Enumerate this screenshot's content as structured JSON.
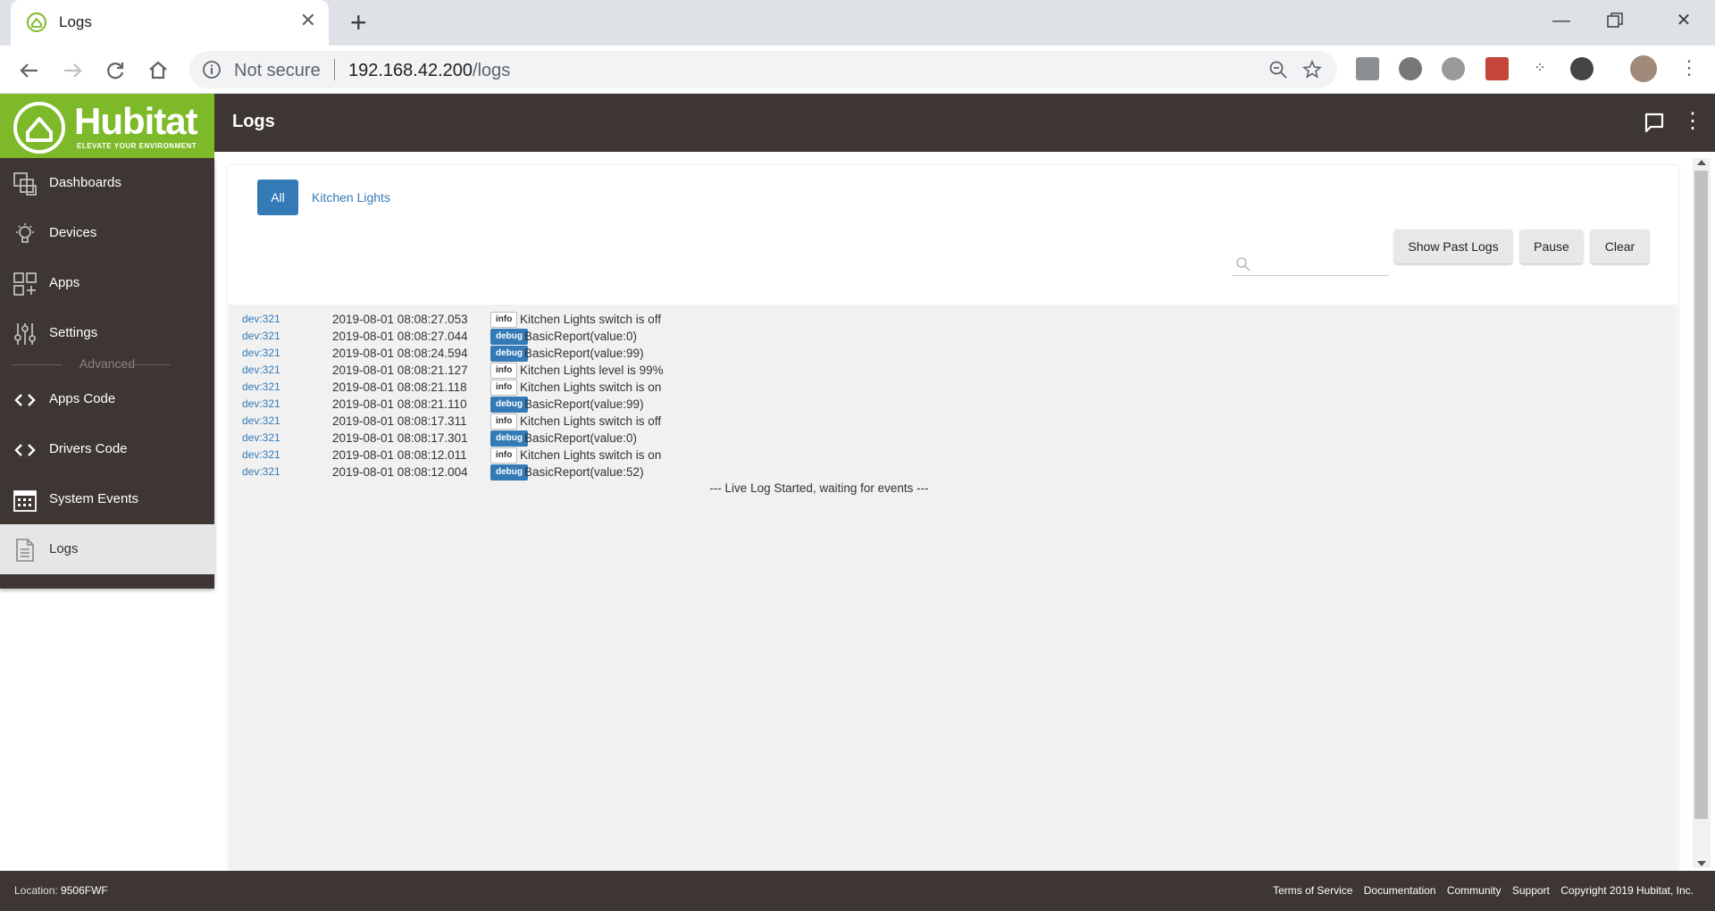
{
  "browser": {
    "tab_title": "Logs",
    "security": "Not secure",
    "url_host": "192.168.42.200",
    "url_path": "/logs"
  },
  "header": {
    "brand": "Hubitat",
    "tagline": "ELEVATE YOUR ENVIRONMENT",
    "title": "Logs"
  },
  "sidebar": {
    "items": [
      {
        "label": "Dashboards",
        "icon": "dashboards-icon"
      },
      {
        "label": "Devices",
        "icon": "lightbulb-icon"
      },
      {
        "label": "Apps",
        "icon": "apps-grid-icon"
      },
      {
        "label": "Settings",
        "icon": "sliders-icon"
      },
      {
        "label": "Apps Code",
        "icon": "code-icon"
      },
      {
        "label": "Drivers Code",
        "icon": "code-icon"
      },
      {
        "label": "System Events",
        "icon": "calendar-icon"
      },
      {
        "label": "Logs",
        "icon": "document-icon",
        "active": true
      }
    ],
    "section_label": "Advanced"
  },
  "filters": {
    "all": "All",
    "kitchen": "Kitchen Lights"
  },
  "search": {
    "placeholder": ""
  },
  "buttons": {
    "past": "Show Past Logs",
    "pause": "Pause",
    "clear": "Clear"
  },
  "logs": [
    {
      "dev": "dev:321",
      "time": "2019-08-01 08:08:27.053",
      "level": "info",
      "msg": "Kitchen Lights switch is off"
    },
    {
      "dev": "dev:321",
      "time": "2019-08-01 08:08:27.044",
      "level": "debug",
      "msg": "BasicReport(value:0)"
    },
    {
      "dev": "dev:321",
      "time": "2019-08-01 08:08:24.594",
      "level": "debug",
      "msg": "BasicReport(value:99)"
    },
    {
      "dev": "dev:321",
      "time": "2019-08-01 08:08:21.127",
      "level": "info",
      "msg": "Kitchen Lights level is 99%"
    },
    {
      "dev": "dev:321",
      "time": "2019-08-01 08:08:21.118",
      "level": "info",
      "msg": "Kitchen Lights switch is on"
    },
    {
      "dev": "dev:321",
      "time": "2019-08-01 08:08:21.110",
      "level": "debug",
      "msg": "BasicReport(value:99)"
    },
    {
      "dev": "dev:321",
      "time": "2019-08-01 08:08:17.311",
      "level": "info",
      "msg": "Kitchen Lights switch is off"
    },
    {
      "dev": "dev:321",
      "time": "2019-08-01 08:08:17.301",
      "level": "debug",
      "msg": "BasicReport(value:0)"
    },
    {
      "dev": "dev:321",
      "time": "2019-08-01 08:08:12.011",
      "level": "info",
      "msg": "Kitchen Lights switch is on"
    },
    {
      "dev": "dev:321",
      "time": "2019-08-01 08:08:12.004",
      "level": "debug",
      "msg": "BasicReport(value:52)"
    }
  ],
  "live_message": "--- Live Log Started, waiting for events ---",
  "footer": {
    "location_label": "Location:",
    "location_value": "9506FWF",
    "links": [
      "Terms of Service",
      "Documentation",
      "Community",
      "Support",
      "Copyright 2019 Hubitat, Inc."
    ]
  },
  "colors": {
    "brand_green": "#7db928",
    "header_brown": "#3e3632",
    "link_blue": "#337ab7"
  }
}
